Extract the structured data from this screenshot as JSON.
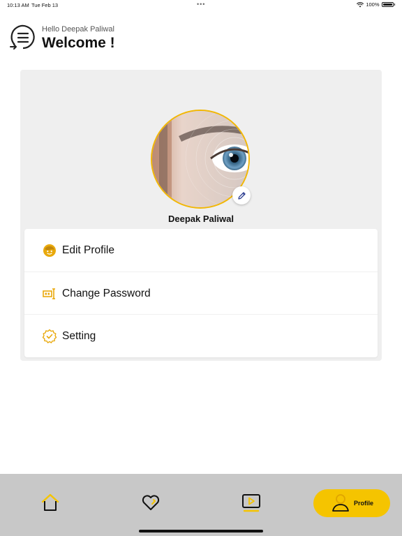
{
  "status_bar": {
    "time": "10:13 AM",
    "date": "Tue Feb 13",
    "battery": "100%"
  },
  "header": {
    "greeting": "Hello Deepak Paliwal",
    "title": "Welcome !"
  },
  "profile": {
    "name": "Deepak Paliwal"
  },
  "menu": [
    {
      "label": "Edit Profile",
      "icon": "face-icon"
    },
    {
      "label": "Change Password",
      "icon": "password-icon"
    },
    {
      "label": "Setting",
      "icon": "gear-badge-icon"
    }
  ],
  "bottom_nav": {
    "items": [
      "home-icon",
      "heart-icon",
      "video-play-icon"
    ],
    "active_label": "Profile"
  },
  "colors": {
    "accent": "#f5c400",
    "accent_icon": "#e9a90c",
    "nav_bg": "#c8c8c8",
    "card_bg": "#efefef"
  }
}
